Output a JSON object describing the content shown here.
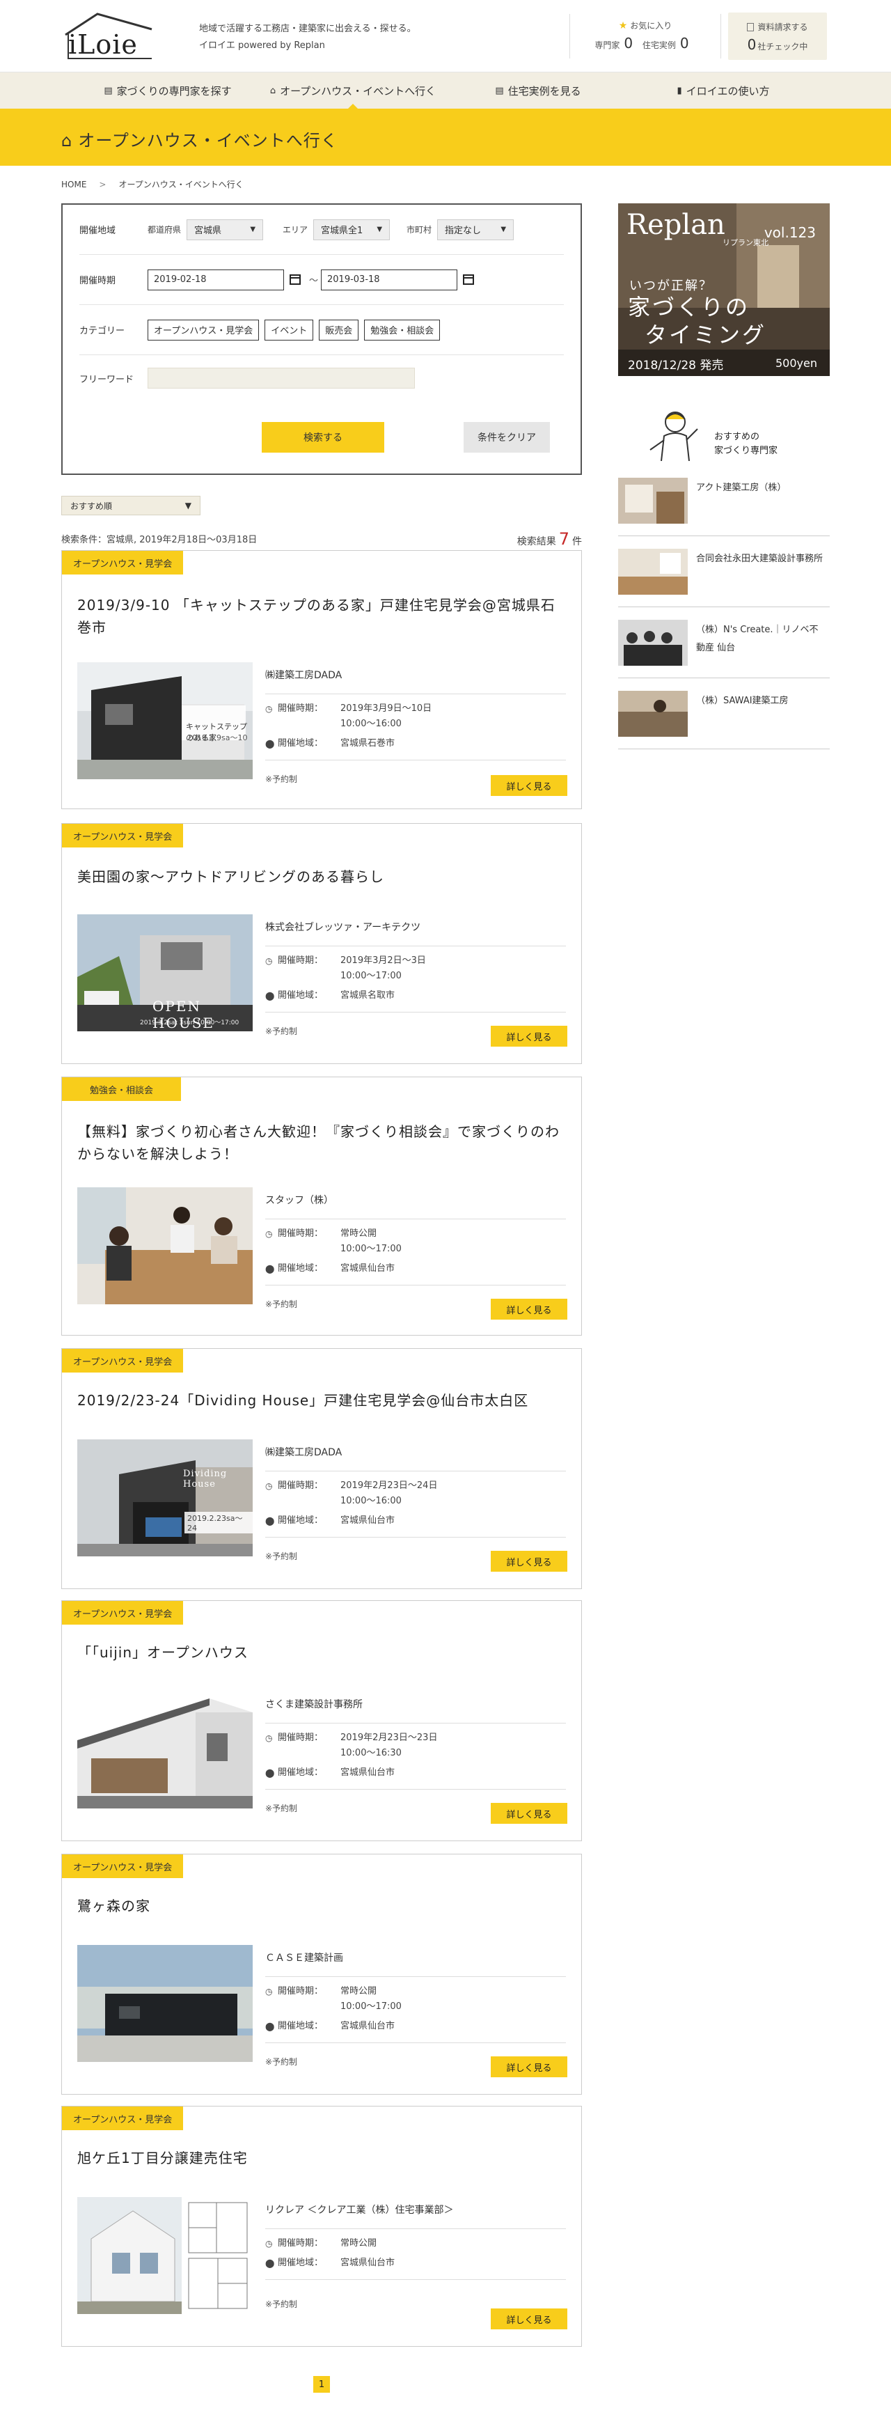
{
  "header": {
    "logo_text": "iLoie",
    "tagline_line1": "地域で活躍する工務店・建築家に出会える・探せる。",
    "tagline_line2": "イロイエ powered by Replan",
    "favorites": {
      "title": "お気に入り",
      "pro_label": "専門家",
      "pro_count": "0",
      "case_label": "住宅実例",
      "case_count": "0"
    },
    "docs": {
      "title": "資料請求する",
      "count": "0",
      "suffix": "社チェック中"
    }
  },
  "nav": [
    {
      "label": "家づくりの専門家を探す",
      "icon": "document-icon"
    },
    {
      "label": "オープンハウス・イベントへ行く",
      "icon": "home-icon"
    },
    {
      "label": "住宅実例を見る",
      "icon": "document-icon"
    },
    {
      "label": "イロイエの使い方",
      "icon": "book-icon"
    }
  ],
  "banner": {
    "title": "オープンハウス・イベントへ行く"
  },
  "breadcrumb": {
    "home": "HOME",
    "current": "オープンハウス・イベントへ行く"
  },
  "search": {
    "area_label": "開催地域",
    "pref_label": "都道府県",
    "pref_value": "宮城県",
    "area_sub_label": "エリア",
    "area_value": "宮城県全1",
    "city_label": "市町村",
    "city_value": "指定なし",
    "period_label": "開催時期",
    "date_from": "2019-02-18",
    "date_tilde": "〜",
    "date_to": "2019-03-18",
    "category_label": "カテゴリー",
    "categories": [
      "オープンハウス・見学会",
      "イベント",
      "販売会",
      "勉強会・相談会"
    ],
    "free_label": "フリーワード",
    "free_value": "",
    "search_button": "検索する",
    "clear_button": "条件をクリア"
  },
  "sort": {
    "value": "おすすめ順"
  },
  "results": {
    "condition": "検索条件：宮城県, 2019年2月18日〜03月18日",
    "count_prefix": "検索結果",
    "count": "7",
    "count_suffix": "件"
  },
  "labels": {
    "date": "開催時期：",
    "location": "開催地域：",
    "more": "詳しく見る"
  },
  "events": [
    {
      "tag": "オープンハウス・見学会",
      "title": "2019/3/9-10 「キャットステップのある家」戸建住宅見学会@宮城県石巻市",
      "company": "㈱建築工房DADA",
      "date": "2019年3月9日〜10日",
      "time": "10:00〜16:00",
      "location": "宮城県石巻市",
      "note": "※予約制"
    },
    {
      "tag": "オープンハウス・見学会",
      "title": "美田園の家〜アウトドアリビングのある暮らし",
      "company": "株式会社ブレッツァ・アーキテクツ",
      "date": "2019年3月2日〜3日",
      "time": "10:00〜17:00",
      "location": "宮城県名取市",
      "note": "※予約制"
    },
    {
      "tag": "勉強会・相談会",
      "title": "【無料】家づくり初心者さん大歓迎！『家づくり相談会』で家づくりのわからないを解決しよう！",
      "company": "スタッフ（株）",
      "date": "常時公開",
      "time": "10:00〜17:00",
      "location": "宮城県仙台市",
      "note": "※予約制"
    },
    {
      "tag": "オープンハウス・見学会",
      "title": "2019/2/23-24「Dividing House」戸建住宅見学会@仙台市太白区",
      "company": "㈱建築工房DADA",
      "date": "2019年2月23日〜24日",
      "time": "10:00〜16:00",
      "location": "宮城県仙台市",
      "note": "※予約制"
    },
    {
      "tag": "オープンハウス・見学会",
      "title": "「「uijin」オープンハウス",
      "company": "さくま建築設計事務所",
      "date": "2019年2月23日〜23日",
      "time": "10:00〜16:30",
      "location": "宮城県仙台市",
      "note": "※予約制"
    },
    {
      "tag": "オープンハウス・見学会",
      "title": "鷺ヶ森の家",
      "company": "ＣＡＳＥ建築計画",
      "date": "常時公開",
      "time": "10:00〜17:00",
      "location": "宮城県仙台市",
      "note": "※予約制"
    },
    {
      "tag": "オープンハウス・見学会",
      "title": "旭ケ丘1丁目分譲建売住宅",
      "company": "リクレア ＜クレア工業（株）住宅事業部＞",
      "date": "常時公開",
      "time": "",
      "location": "宮城県仙台市",
      "note": "※予約制"
    }
  ],
  "image_text": {
    "e1_1": "キャットステップのある家",
    "e1_2": "2019.3.9sa〜10",
    "e2_1": "OPEN HOUSE",
    "e2_2": "2019.3.2sat  3sun  10:00〜17:00",
    "e4_1": "Dividing House",
    "e4_2": "2019.2.23sa〜24"
  },
  "sidebar": {
    "magazine": {
      "brand": "Replan",
      "region": "リプラン東北",
      "vol": "vol.123",
      "subtitle": "いつが正解？",
      "title_line1": "家づくりの",
      "title_line2": "タイミング",
      "release": "2018/12/28 発売",
      "price": "500yen"
    },
    "pros_title_line1": "おすすめの",
    "pros_title_line2": "家づくり専門家",
    "pros": [
      "アクト建築工房（株）",
      "合同会社永田大建築設計事務所",
      "（株）N's Create.｜リノベ不動産 仙台",
      "（株）SAWAI建築工房"
    ]
  },
  "pagination": {
    "current": "1"
  },
  "colors": {
    "accent": "#f8cd1b",
    "nav_bg": "#f2eee2",
    "count": "#c62828"
  }
}
